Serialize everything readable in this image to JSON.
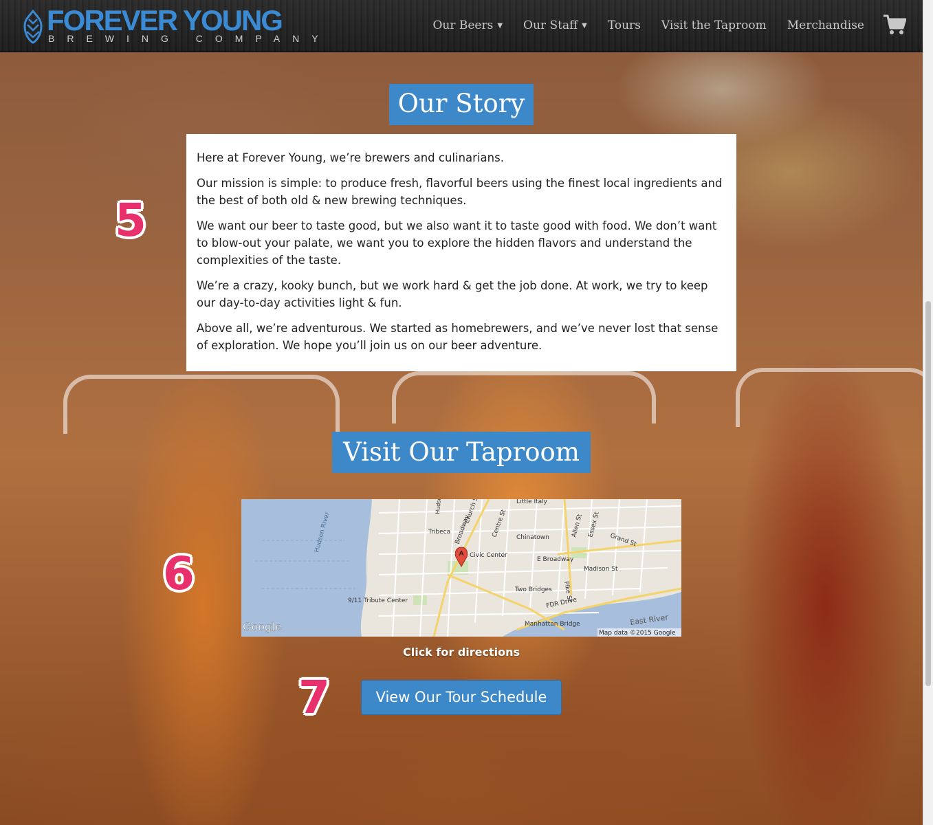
{
  "brand": {
    "name": "FOREVER YOUNG",
    "subtitle": "BREWING COMPANY",
    "color": "#3a8ad4"
  },
  "nav": {
    "items": [
      {
        "label": "Our Beers",
        "dropdown": true
      },
      {
        "label": "Our Staff",
        "dropdown": true
      },
      {
        "label": "Tours",
        "dropdown": false
      },
      {
        "label": "Visit the Taproom",
        "dropdown": false
      },
      {
        "label": "Merchandise",
        "dropdown": false
      }
    ],
    "cart_icon": "shopping-cart-icon"
  },
  "story": {
    "heading": "Our Story",
    "paragraphs": [
      "Here at Forever Young, we’re brewers and culinarians.",
      "Our mission is simple: to produce fresh, flavorful beers using the finest local ingredients and the best of both old & new brewing techniques.",
      "We want our beer to taste good, but we also want it to taste good with food. We don’t want to blow-out your palate, we want you to explore the hidden flavors and understand the complexities of the taste.",
      "We’re a crazy, kooky bunch, but we work hard & get the job done. At work, we try to keep our day-to-day activities light & fun.",
      "Above all, we’re adventurous. We started as homebrewers, and we’ve never lost that sense of exploration. We hope you’ll join us on our beer adventure."
    ]
  },
  "taproom": {
    "heading": "Visit Our Taproom",
    "map": {
      "labels": [
        "Little Italy",
        "Tribeca",
        "Chinatown",
        "Civic Center",
        "E Broadway",
        "Madison St",
        "Two Bridges",
        "FDR Drive",
        "Manhattan Bridge",
        "East River",
        "9/11 Tribute Center",
        "Hudson River",
        "Church St",
        "Centre St",
        "Allen St",
        "Essex St",
        "Grand St",
        "Pike St",
        "Broadway",
        "Hudson"
      ],
      "marker": "A",
      "google_logo": "Google",
      "attribution": "Map data ©2015 Google"
    },
    "caption": "Click for directions",
    "tour_button": "View Our Tour Schedule"
  },
  "annotations": [
    "5",
    "6",
    "7"
  ],
  "colors": {
    "accent": "#3d88c8",
    "annotation": "#e8306c"
  }
}
